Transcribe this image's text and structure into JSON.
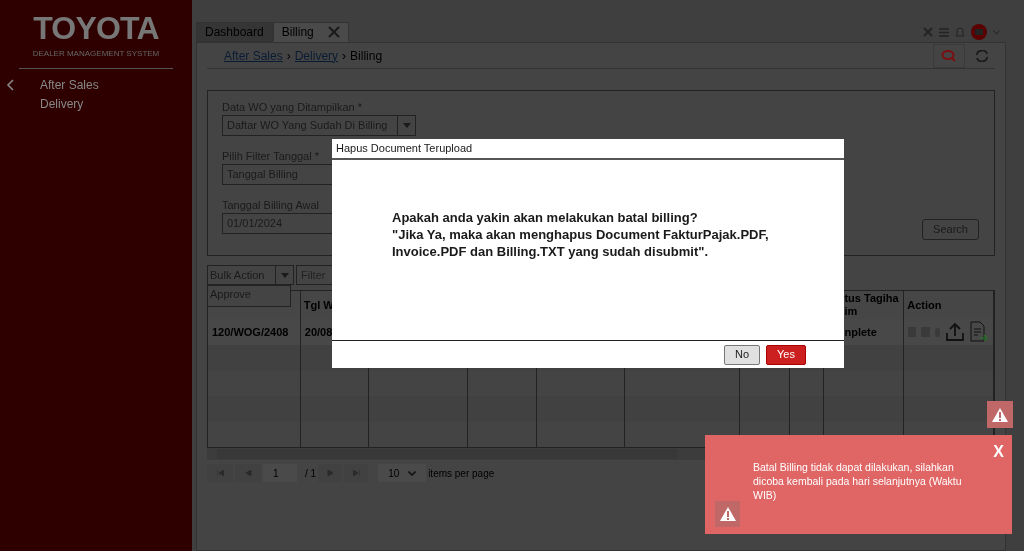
{
  "sidebar": {
    "logo": "TOYOTA",
    "subtitle": "DEALER MANAGEMENT SYSTEM",
    "menu": [
      "After Sales",
      "Delivery"
    ]
  },
  "tabs": [
    {
      "label": "Dashboard",
      "selected": false,
      "closable": false
    },
    {
      "label": "Billing",
      "selected": true,
      "closable": true
    }
  ],
  "breadcrumb": [
    {
      "label": "After Sales",
      "link": true
    },
    {
      "separator": "›",
      "label": "Delivery",
      "link": true
    },
    {
      "separator": "›",
      "label": "Billing",
      "link": false
    }
  ],
  "filters": [
    {
      "label": "Data WO yang Ditampilkan *",
      "value": "Daftar WO Yang Sudah Di Billing",
      "kind": "select"
    },
    {
      "label": "Pilih Filter Tanggal *",
      "value": "Tanggal Billing",
      "kind": "text"
    },
    {
      "label": "Tanggal Billing Awal",
      "value": "01/01/2024",
      "kind": "text"
    }
  ],
  "search_button": "Search",
  "bulk_action": {
    "label": "Bulk Action",
    "options": [
      "Approve"
    ],
    "expanded": true
  },
  "filter_field": {
    "placeholder": "Filter"
  },
  "table": {
    "columns": [
      {},
      {
        "header": "Tgl W"
      },
      {},
      {},
      {},
      {},
      {},
      {},
      {
        "header": "tus Tagiha im"
      },
      {
        "header": "Action"
      }
    ],
    "rows": [
      {
        "cells": [
          {
            "text": "120/WOG/2408"
          },
          {
            "text": "20/08"
          },
          {},
          {},
          {},
          {},
          {},
          {},
          {
            "text": "nplete"
          },
          {}
        ],
        "actions": true
      }
    ]
  },
  "pagination": {
    "page": "1",
    "total": "/ 1",
    "per_page": "10",
    "per_page_label": "items per page"
  },
  "dialog": {
    "title": "Hapus Document Terupload",
    "message": [
      "Apakah anda yakin akan melakukan batal billing?",
      "\"Jika Ya, maka akan menghapus Document FakturPajak.PDF, Invoice.PDF dan Billing.TXT yang sudah disubmit\"."
    ],
    "buttons": [
      {
        "label": "No",
        "kind": "secondary"
      },
      {
        "label": "Yes",
        "kind": "primary"
      }
    ]
  },
  "toast": {
    "message": "Batal Billing tidak dapat dilakukan, silahkan dicoba kembali pada hari selanjutnya (Waktu WIB)",
    "close": "X"
  }
}
